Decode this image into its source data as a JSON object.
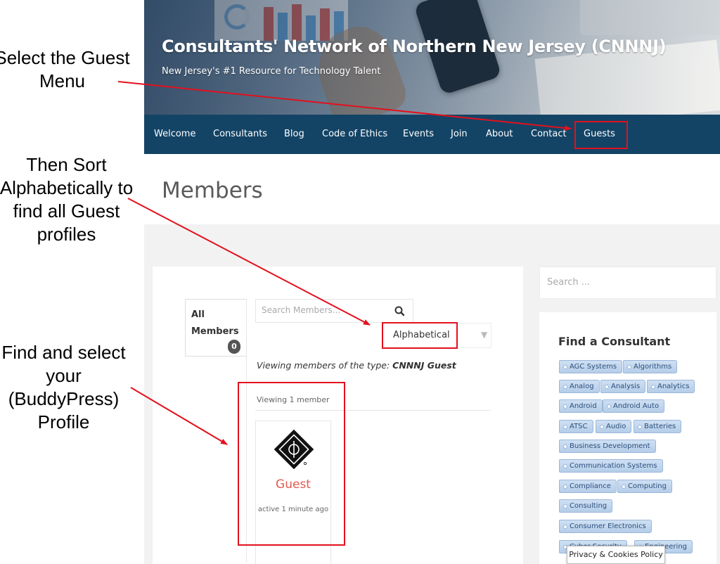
{
  "annotations": {
    "step1": "Select the Guest Menu",
    "step2": "Then Sort Alphabetically to find all Guest profiles",
    "step3": "Find and select your (BuddyPress) Profile"
  },
  "header": {
    "title": "Consultants' Network of Northern New Jersey (CNNNJ)",
    "tagline": "New Jersey's #1 Resource for Technology Talent"
  },
  "nav": {
    "items": [
      {
        "label": "Welcome"
      },
      {
        "label": "Consultants"
      },
      {
        "label": "Blog"
      },
      {
        "label": "Code of Ethics"
      },
      {
        "label": "Events"
      },
      {
        "label": "Join"
      },
      {
        "label": "About"
      },
      {
        "label": "Contact"
      },
      {
        "label": "Guests"
      }
    ]
  },
  "page": {
    "title": "Members"
  },
  "directory": {
    "tab_label": "All Members",
    "tab_count": "0",
    "search_placeholder": "Search Members...",
    "sort_value": "Alphabetical",
    "type_prefix": "Viewing members of the type:",
    "type_name": "CNNNJ Guest",
    "viewing_count": "Viewing 1 member",
    "members": [
      {
        "name": "Guest",
        "last_active": "active 1 minute ago"
      }
    ]
  },
  "sidebar": {
    "search_placeholder": "Search ...",
    "widget_title": "Find a Consultant",
    "tags": [
      "AGC Systems",
      "Algorithms",
      "Analog",
      "Analysis",
      "Analytics",
      "Android",
      "Android Auto",
      "ATSC",
      "Audio",
      "Batteries",
      "Business Development",
      "Communication Systems",
      "Compliance",
      "Computing",
      "Consulting",
      "Consumer Electronics",
      "Cyber Security",
      "Engineering"
    ]
  },
  "cookie_notice": "Privacy & Cookies Policy",
  "colors": {
    "nav_bg": "#134466",
    "annotation_red": "#e3101d",
    "member_name": "#e05a4e",
    "tag_bg": "#c4d8ef"
  }
}
